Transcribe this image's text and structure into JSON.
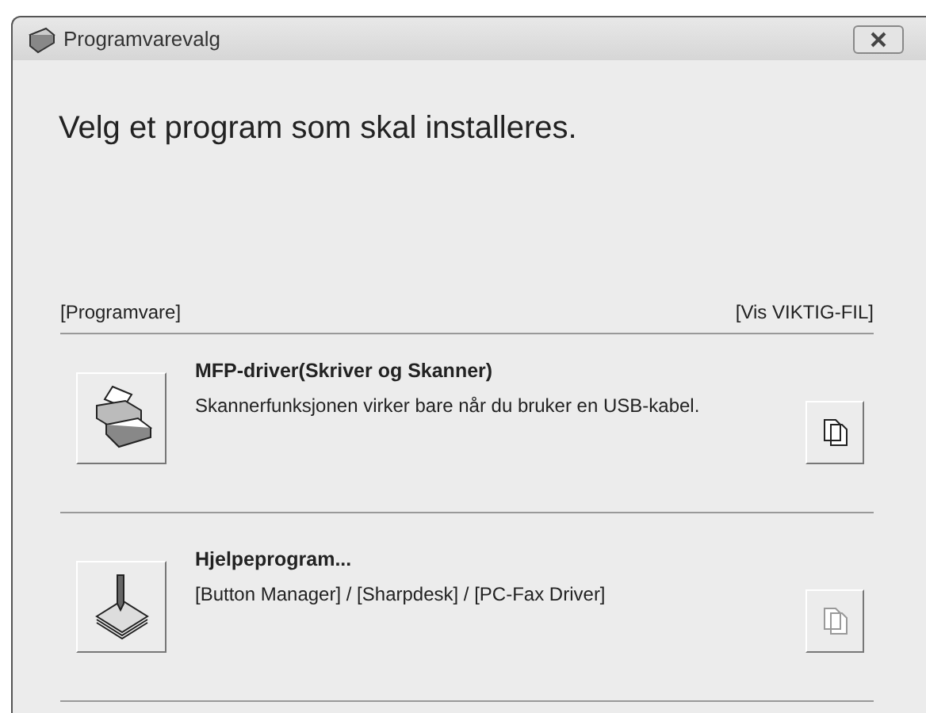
{
  "window": {
    "title": "Programvarevalg"
  },
  "heading": "Velg et program som skal installeres.",
  "section": {
    "label": "[Programvare]",
    "link": "[Vis VIKTIG-FIL]"
  },
  "items": [
    {
      "kind": "printer",
      "title": "MFP-driver(Skriver og Skanner)",
      "description": "Skannerfunksjonen virker bare når du bruker en USB-kabel.",
      "doc_disabled": false
    },
    {
      "kind": "tools",
      "title": "Hjelpeprogram...",
      "description": "[Button Manager] / [Sharpdesk] / [PC-Fax Driver]",
      "doc_disabled": true
    }
  ]
}
